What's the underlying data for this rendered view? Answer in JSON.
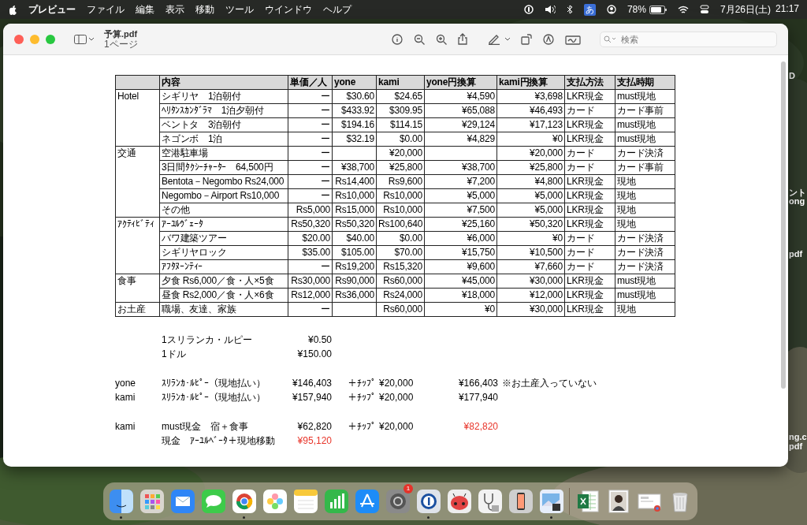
{
  "menu_bar": {
    "app": "プレビュー",
    "items": [
      "ファイル",
      "編集",
      "表示",
      "移動",
      "ツール",
      "ウインドウ",
      "ヘルプ"
    ],
    "input_mode": "あ",
    "battery": "78%",
    "date": "7月26日(土)",
    "time": "21:17"
  },
  "desktop_labels": [
    "D",
    "ント",
    "ong",
    "pdf",
    "ng.c",
    "pdf"
  ],
  "window": {
    "title": "予算.pdf",
    "subtitle": "1ページ",
    "search": {
      "placeholder": "検索"
    }
  },
  "table": {
    "columns": [
      "",
      "内容",
      "単価／人",
      "yone",
      "kami",
      "yone円換算",
      "kami円換算",
      "支払方法",
      "支払時期"
    ],
    "groups": [
      {
        "category": "Hotel",
        "rows": [
          [
            "シギリヤ　1泊朝付",
            "ー",
            "$30.60",
            "$24.65",
            "¥4,590",
            "¥3,698",
            "LKR現金",
            "must現地"
          ],
          [
            "ﾍﾘﾀﾝｽｶﾝﾀﾞﾗﾏ　1泊夕朝付",
            "ー",
            "$433.92",
            "$309.95",
            "¥65,088",
            "¥46,493",
            "カード",
            "カード事前"
          ],
          [
            "ベントタ　3泊朝付",
            "ー",
            "$194.16",
            "$114.15",
            "¥29,124",
            "¥17,123",
            "LKR現金",
            "must現地"
          ],
          [
            "ネゴンボ　1泊",
            "ー",
            "$32.19",
            "$0.00",
            "¥4,829",
            "¥0",
            "LKR現金",
            "must現地"
          ]
        ]
      },
      {
        "category": "交通",
        "rows": [
          [
            "空港駐車場",
            "ー",
            "",
            "¥20,000",
            "",
            "¥20,000",
            "カード",
            "カード決済"
          ],
          [
            "3日間ﾀｸｼｰﾁｬｰﾀｰ　64,500円",
            "ー",
            "¥38,700",
            "¥25,800",
            "¥38,700",
            "¥25,800",
            "カード",
            "カード事前"
          ],
          [
            "Bentota－Negombo Rs24,000",
            "ー",
            "Rs14,400",
            "Rs9,600",
            "¥7,200",
            "¥4,800",
            "LKR現金",
            "現地"
          ],
          [
            "Negombo－Airport Rs10,000",
            "ー",
            "Rs10,000",
            "Rs10,000",
            "¥5,000",
            "¥5,000",
            "LKR現金",
            "現地"
          ],
          [
            "その他",
            "Rs5,000",
            "Rs15,000",
            "Rs10,000",
            "¥7,500",
            "¥5,000",
            "LKR現金",
            "現地"
          ]
        ]
      },
      {
        "category": "ｱｸﾃｨﾋﾞﾃｨ",
        "rows": [
          [
            "ｱｰﾕﾙｳﾞｪｰﾀ",
            "Rs50,320",
            "Rs50,320",
            "Rs100,640",
            "¥25,160",
            "¥50,320",
            "LKR現金",
            "現地"
          ],
          [
            "バワ建築ツアー",
            "$20.00",
            "$40.00",
            "$0.00",
            "¥6,000",
            "¥0",
            "カード",
            "カード決済"
          ],
          [
            "シギリヤロック",
            "$35.00",
            "$105.00",
            "$70.00",
            "¥15,750",
            "¥10,500",
            "カード",
            "カード決済"
          ],
          [
            "ｱﾌﾀﾇｰﾝﾃｨｰ",
            "ー",
            "Rs19,200",
            "Rs15,320",
            "¥9,600",
            "¥7,660",
            "カード",
            "カード決済"
          ]
        ]
      },
      {
        "category": "食事",
        "rows": [
          [
            "夕食 Rs6,000／食・人×5食",
            "Rs30,000",
            "Rs90,000",
            "Rs60,000",
            "¥45,000",
            "¥30,000",
            "LKR現金",
            "must現地"
          ],
          [
            "昼食 Rs2,000／食・人×6食",
            "Rs12,000",
            "Rs36,000",
            "Rs24,000",
            "¥18,000",
            "¥12,000",
            "LKR現金",
            "must現地"
          ]
        ]
      },
      {
        "category": "お土産",
        "rows": [
          [
            "職場、友達、家族",
            "ー",
            "",
            "Rs60,000",
            "¥0",
            "¥30,000",
            "LKR現金",
            "現地"
          ]
        ]
      }
    ]
  },
  "summary": [
    [
      {
        "description": "1スリランカ・ルピー",
        "amount": "¥0.50",
        "amount_highlight": false
      },
      {
        "description": "1ドル",
        "amount": "¥150.00",
        "amount_highlight": false
      }
    ],
    [
      {
        "label": "yone",
        "description": "ｽﾘﾗﾝｶ･ﾙﾋﾟｰ（現地払い）",
        "amount": "¥146,403",
        "amount_highlight": false,
        "tip_label": "＋ﾁｯﾌﾟ",
        "tip": "¥20,000",
        "total": "¥166,403",
        "total_highlight": false,
        "note": "※お土産入っていない"
      },
      {
        "label": "kami",
        "description": "ｽﾘﾗﾝｶ･ﾙﾋﾟｰ（現地払い）",
        "amount": "¥157,940",
        "amount_highlight": false,
        "tip_label": "＋ﾁｯﾌﾟ",
        "tip": "¥20,000",
        "total": "¥177,940",
        "total_highlight": false
      }
    ],
    [
      {
        "label": "kami",
        "description": "must現金　宿＋食事",
        "amount": "¥62,820",
        "amount_highlight": false,
        "tip_label": "＋ﾁｯﾌﾟ",
        "tip": "¥20,000",
        "total": "¥82,820",
        "total_highlight": true
      },
      {
        "description": "現金　ｱｰﾕﾙﾍﾞｰﾀ＋現地移動",
        "amount": "¥95,120",
        "amount_highlight": true
      }
    ]
  ],
  "dock": {
    "items": [
      {
        "kind": "finder",
        "running": true
      },
      {
        "kind": "launcher",
        "running": false
      },
      {
        "kind": "mail",
        "running": false
      },
      {
        "kind": "messages",
        "running": false
      },
      {
        "kind": "browser",
        "running": true
      },
      {
        "kind": "photos",
        "running": false
      },
      {
        "kind": "notes",
        "running": false
      },
      {
        "kind": "numbers",
        "running": false
      },
      {
        "kind": "store",
        "running": false
      },
      {
        "kind": "settings",
        "running": false,
        "badge": "1"
      },
      {
        "kind": "password",
        "running": true
      },
      {
        "kind": "bug",
        "running": false
      },
      {
        "kind": "utility",
        "running": false
      },
      {
        "kind": "phone",
        "running": false
      },
      {
        "kind": "preview",
        "running": true
      },
      {
        "kind": "separator"
      },
      {
        "kind": "spreadsheet",
        "running": false
      },
      {
        "kind": "portrait",
        "running": false
      },
      {
        "kind": "document",
        "running": false
      },
      {
        "kind": "trash",
        "running": false
      }
    ]
  }
}
